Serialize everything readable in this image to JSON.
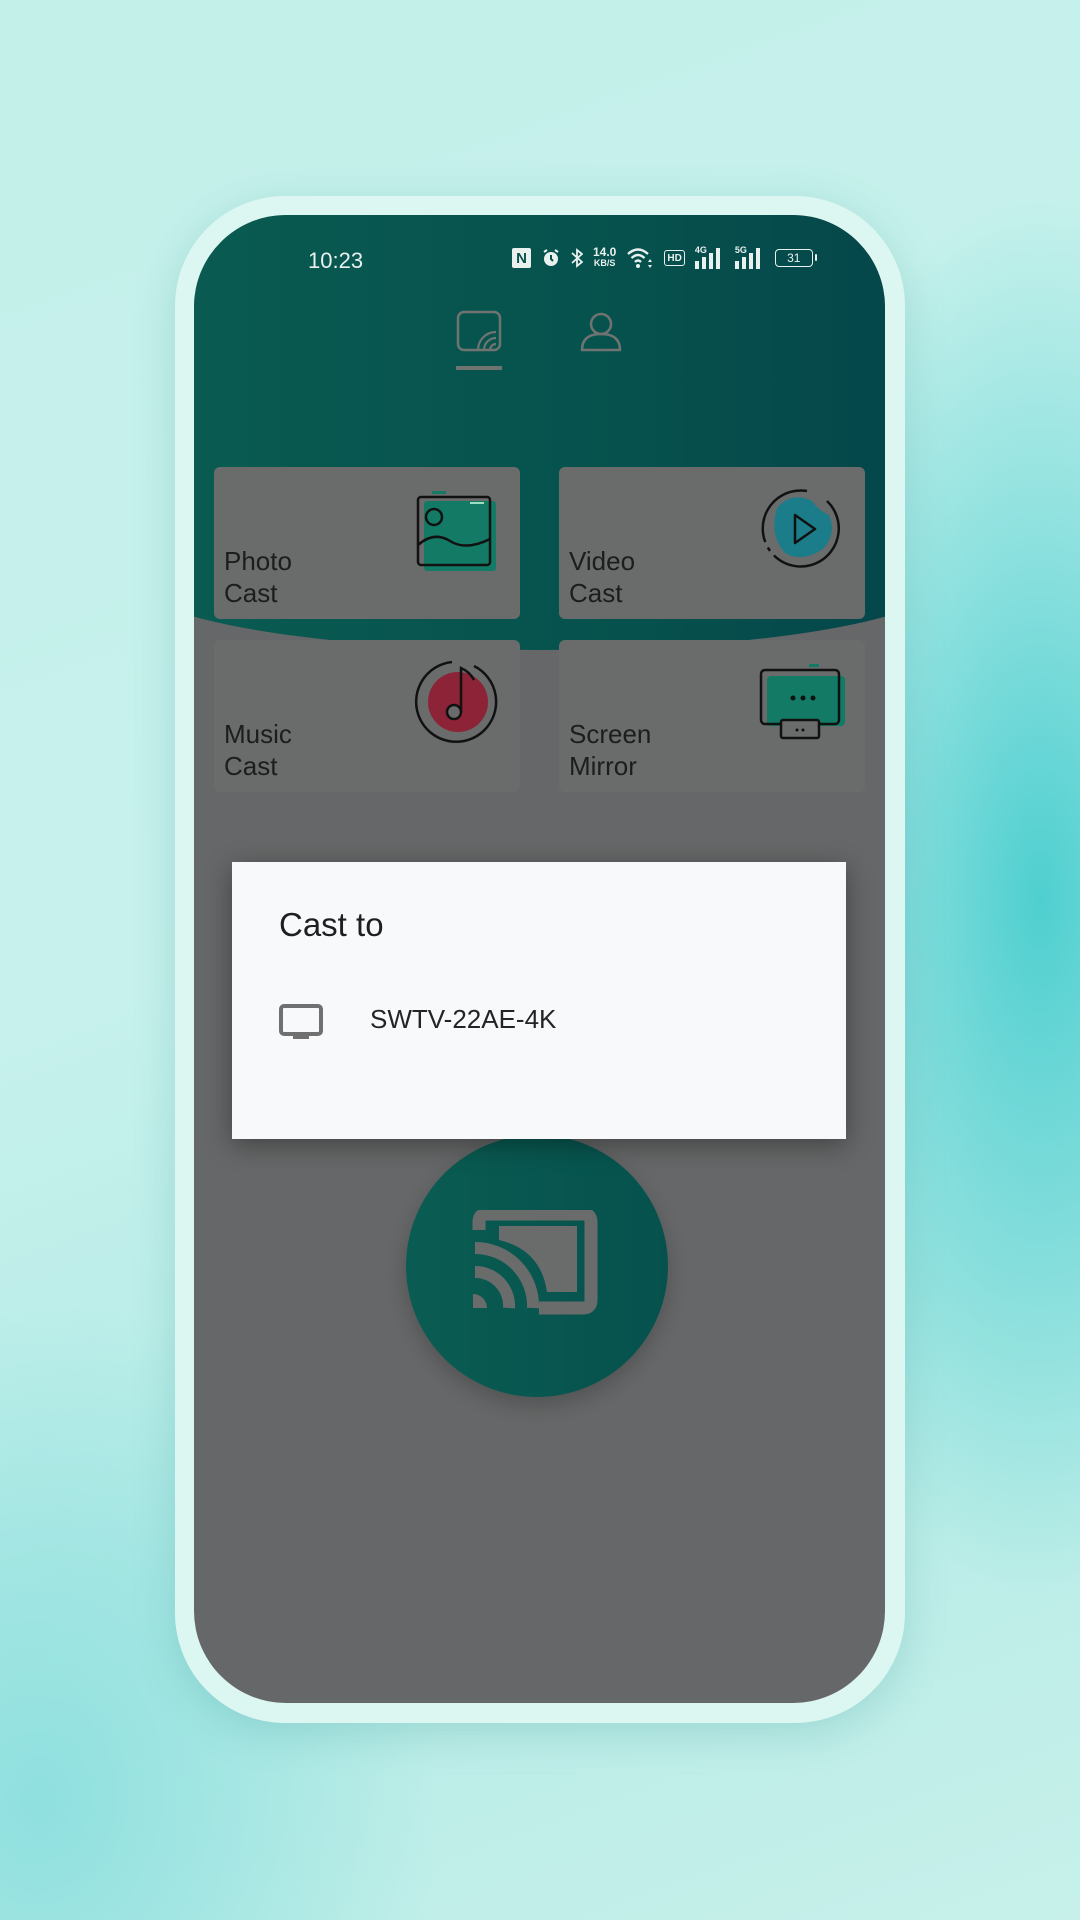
{
  "status_bar": {
    "time": "10:23",
    "icons": [
      "nfc-icon",
      "alarm-icon",
      "bluetooth-icon",
      "network-speed",
      "wifi-icon",
      "hd-voice-icon",
      "signal-4g-icon",
      "signal-5g-icon",
      "battery-icon"
    ],
    "network_speed_value": "14.0",
    "network_speed_unit": "KB/S",
    "hd_label": "HD",
    "signal1_label": "4G",
    "signal2_label": "5G",
    "battery_level": "31"
  },
  "tabs": [
    {
      "name": "cast",
      "icon": "cast-tab-icon",
      "selected": true
    },
    {
      "name": "profile",
      "icon": "user-icon",
      "selected": false
    }
  ],
  "features": [
    {
      "label": "Photo\nCast",
      "icon": "photo-icon"
    },
    {
      "label": "Video\nCast",
      "icon": "video-play-icon"
    },
    {
      "label": "Music\nCast",
      "icon": "music-disc-icon"
    },
    {
      "label": "Screen\nMirror",
      "icon": "screen-mirror-icon"
    }
  ],
  "colors": {
    "header": "#06514d",
    "accent_teal": "#0a5c52",
    "photo_icon": "#137a66",
    "video_icon": "#1b7d8a",
    "music_icon": "#8c2336",
    "scrim": "#666768",
    "dialog_bg": "#f8f9fb"
  },
  "cast_button": {
    "icon": "cast-icon"
  },
  "dialog": {
    "title": "Cast to",
    "devices": [
      {
        "name": "SWTV-22AE-4K",
        "icon": "tv-icon"
      }
    ]
  }
}
